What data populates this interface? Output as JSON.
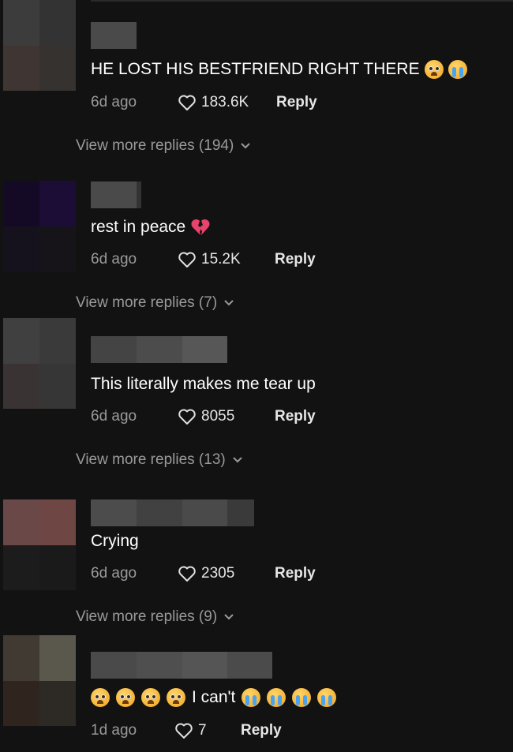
{
  "comments": [
    {
      "text": "HE LOST HIS BESTFRIEND RIGHT THERE",
      "time": "6d ago",
      "likes": "183.6K",
      "reply": "Reply",
      "more": "View more replies (194)",
      "emojis_after": [
        "pleading-face-icon",
        "loudly-crying-face-icon"
      ],
      "avatar_colors": [
        "#3c3c3c",
        "#333333",
        "#3f3633",
        "#353230"
      ],
      "username_colors": [
        "#4a4a4a"
      ]
    },
    {
      "text": "rest in peace",
      "time": "6d ago",
      "likes": "15.2K",
      "reply": "Reply",
      "more": "View more replies (7)",
      "emojis_after": [
        "broken-heart-icon"
      ],
      "avatar_colors": [
        "#140a25",
        "#1b0d36",
        "#16121d",
        "#161418"
      ],
      "username_colors": [
        "#4a4a4a",
        "#333333"
      ]
    },
    {
      "text": "This literally makes me tear up",
      "time": "6d ago",
      "likes": "8055",
      "reply": "Reply",
      "more": "View more replies (13)",
      "emojis_after": [],
      "avatar_colors": [
        "#404040",
        "#3a3a3a",
        "#3a3333",
        "#363636"
      ],
      "username_colors": [
        "#444444",
        "#4c4c4c",
        "#474747",
        "#575757"
      ]
    },
    {
      "text": "Crying",
      "time": "6d ago",
      "likes": "2305",
      "reply": "Reply",
      "more": "View more replies (9)",
      "emojis_after": [],
      "avatar_colors": [
        "#6a4848",
        "#6e4745",
        "#1c1c1c",
        "#1a1a1a"
      ],
      "username_colors": [
        "#4c4c4c",
        "#414141",
        "#4a4a4a",
        "#3a3a3a"
      ]
    },
    {
      "text": "I can't",
      "time": "1d ago",
      "likes": "7",
      "reply": "Reply",
      "more": "",
      "emojis_before": [
        "pleading-face-icon",
        "pleading-face-icon",
        "pleading-face-icon",
        "pleading-face-icon"
      ],
      "emojis_after": [
        "loudly-crying-face-icon",
        "loudly-crying-face-icon",
        "loudly-crying-face-icon",
        "loudly-crying-face-icon"
      ],
      "avatar_colors": [
        "#413a33",
        "#5a574c",
        "#30241f",
        "#2d2a25"
      ],
      "username_colors": [
        "#4a4a4a",
        "#4f4f4f",
        "#555555",
        "#4b4b4b"
      ]
    }
  ]
}
